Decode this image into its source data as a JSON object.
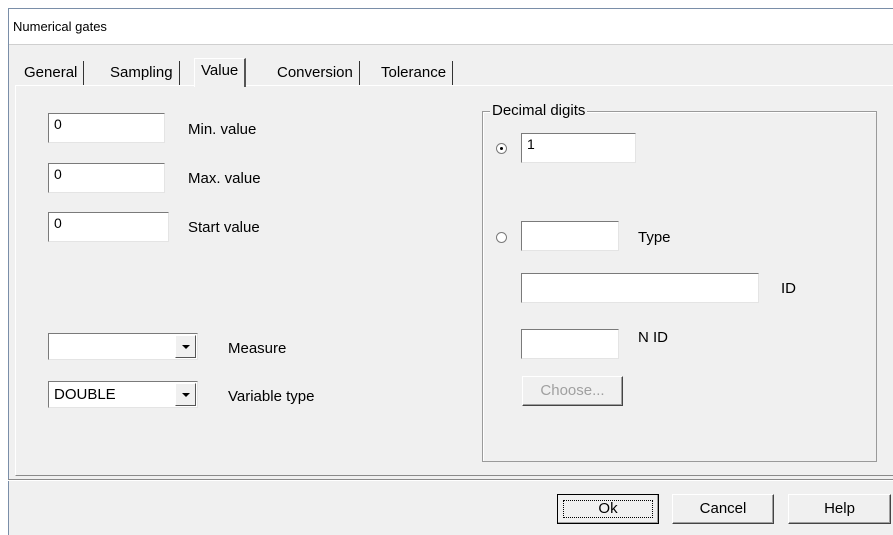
{
  "window": {
    "title": "Numerical gates"
  },
  "tabs": [
    {
      "label": "General"
    },
    {
      "label": "Sampling"
    },
    {
      "label": "Value"
    },
    {
      "label": "Conversion"
    },
    {
      "label": "Tolerance"
    }
  ],
  "active_tab": "Value",
  "value_tab": {
    "min": {
      "value": "0",
      "label": "Min. value"
    },
    "max": {
      "value": "0",
      "label": "Max. value"
    },
    "start": {
      "value": "0",
      "label": "Start value"
    },
    "measure": {
      "value": "",
      "label": "Measure"
    },
    "variable_type": {
      "value": "DOUBLE",
      "label": "Variable type"
    }
  },
  "decimal_digits": {
    "title": "Decimal digits",
    "fixed_value": "1",
    "type_value": "",
    "type_label": "Type",
    "id_value": "",
    "id_label": "ID",
    "nid_value": "",
    "nid_label": "N ID",
    "choose_label": "Choose..."
  },
  "buttons": {
    "ok": "Ok",
    "cancel": "Cancel",
    "help": "Help"
  }
}
